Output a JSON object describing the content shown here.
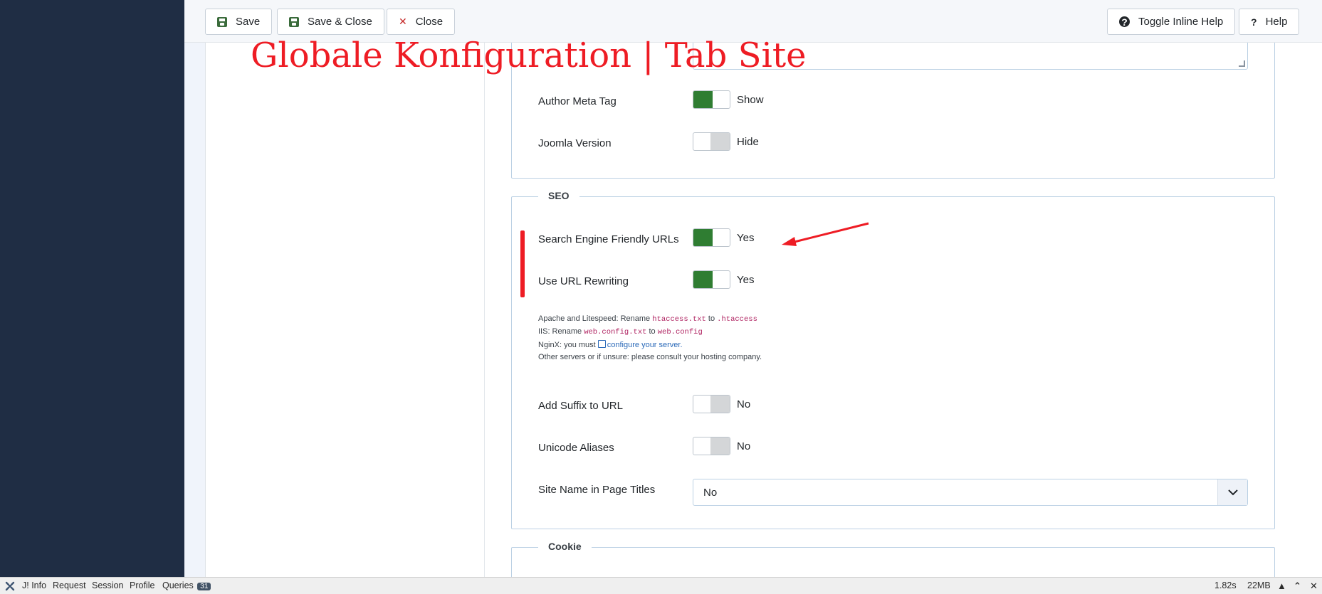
{
  "toolbar": {
    "save": "Save",
    "save_close": "Save & Close",
    "close": "Close",
    "toggle_help": "Toggle Inline Help",
    "help": "Help"
  },
  "overlay_title": "Globale Konfiguration | Tab Site",
  "metadata": {
    "author_meta_tag": {
      "label": "Author Meta Tag",
      "value": "Show",
      "on": true
    },
    "joomla_version": {
      "label": "Joomla Version",
      "value": "Hide",
      "on": false
    }
  },
  "seo": {
    "legend": "SEO",
    "sef_urls": {
      "label": "Search Engine Friendly URLs",
      "value": "Yes",
      "on": true
    },
    "url_rewriting": {
      "label": "Use URL Rewriting",
      "value": "Yes",
      "on": true
    },
    "hints": {
      "apache_prefix": "Apache and Litespeed: Rename",
      "apache_from": "htaccess.txt",
      "to1": "to",
      "apache_to": ".htaccess",
      "iis_prefix": "IIS: Rename",
      "iis_from": "web.config.txt",
      "to2": "to",
      "iis_to": "web.config",
      "nginx_prefix": "NginX: you must",
      "nginx_link": "configure your server.",
      "other": "Other servers or if unsure: please consult your hosting company."
    },
    "add_suffix": {
      "label": "Add Suffix to URL",
      "value": "No",
      "on": false
    },
    "unicode_aliases": {
      "label": "Unicode Aliases",
      "value": "No",
      "on": false
    },
    "site_name_titles": {
      "label": "Site Name in Page Titles",
      "value": "No"
    }
  },
  "cookie": {
    "legend": "Cookie"
  },
  "debugbar": {
    "info": "J! Info",
    "request": "Request",
    "session": "Session",
    "profile": "Profile",
    "queries": "Queries",
    "queries_count": "31",
    "time": "1.82s",
    "memory": "22MB"
  },
  "colors": {
    "sidebar": "#1f2d44",
    "switch_on": "#2f7d32",
    "annotation_red": "#ee1c24"
  }
}
